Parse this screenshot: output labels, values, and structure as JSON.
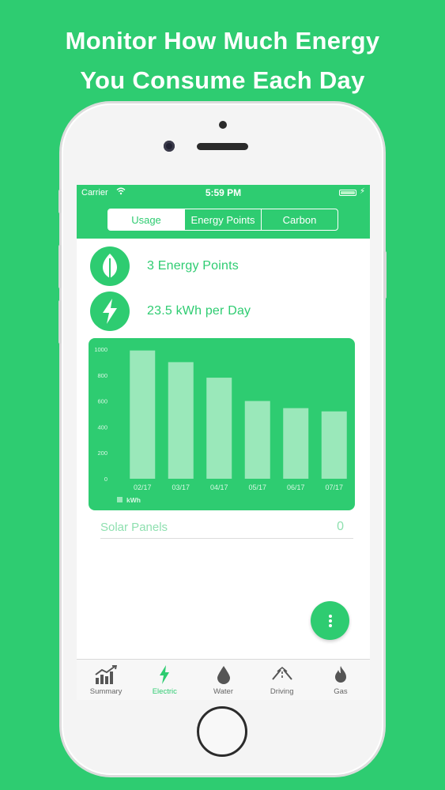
{
  "promo": {
    "line1": "Monitor How Much Energy",
    "line2": "You  Consume Each Day"
  },
  "status_bar": {
    "carrier": "Carrier",
    "time": "5:59 PM"
  },
  "segments": [
    {
      "label": "Usage",
      "active": true
    },
    {
      "label": "Energy Points",
      "active": false
    },
    {
      "label": "Carbon",
      "active": false
    }
  ],
  "stats": {
    "energy_points": "3 Energy Points",
    "daily_usage": "23.5 kWh per Day"
  },
  "chart_data": {
    "type": "bar",
    "categories": [
      "02/17",
      "03/17",
      "04/17",
      "05/17",
      "06/17",
      "07/17"
    ],
    "series": [
      {
        "name": "kWh",
        "values": [
          990,
          900,
          780,
          600,
          545,
          520
        ]
      }
    ],
    "yticks": [
      "0",
      "200",
      "400",
      "600",
      "800",
      "1000"
    ],
    "ylim": [
      0,
      1000
    ],
    "legend": "bottom-left",
    "grid": false
  },
  "solar": {
    "label": "Solar Panels",
    "value": "0"
  },
  "fab_icon": "more-vertical-icon",
  "tabs": [
    {
      "label": "Summary",
      "icon": "bar-chart-icon",
      "active": false
    },
    {
      "label": "Electric",
      "icon": "lightning-icon",
      "active": true
    },
    {
      "label": "Water",
      "icon": "water-drop-icon",
      "active": false
    },
    {
      "label": "Driving",
      "icon": "road-icon",
      "active": false
    },
    {
      "label": "Gas",
      "icon": "flame-icon",
      "active": false
    }
  ],
  "colors": {
    "brand": "#2ecc71",
    "bar": "#9ae8ba",
    "text_inactive": "#666666"
  }
}
